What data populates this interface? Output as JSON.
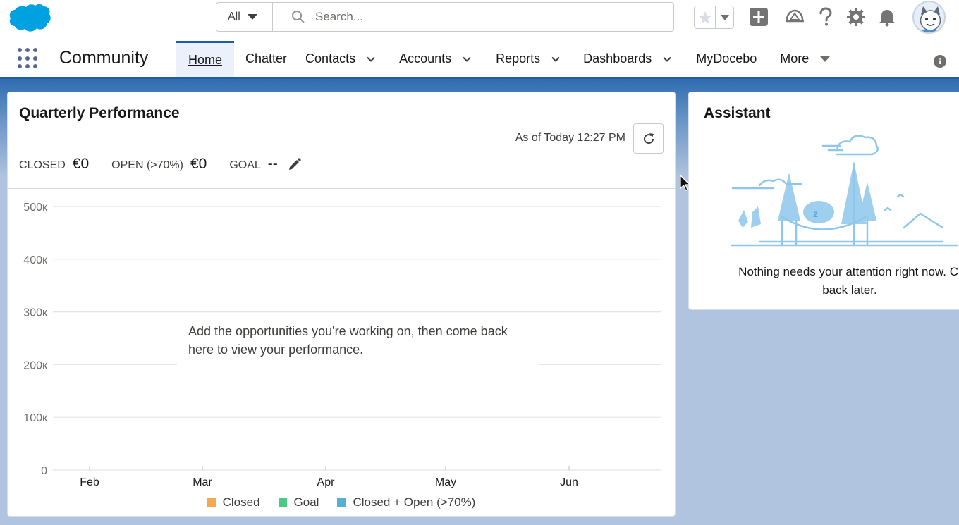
{
  "header": {
    "search_scope": "All",
    "search_placeholder": "Search..."
  },
  "nav": {
    "app_name": "Community",
    "items": [
      {
        "label": "Home",
        "active": true,
        "dropdown": false
      },
      {
        "label": "Chatter",
        "active": false,
        "dropdown": false
      },
      {
        "label": "Contacts",
        "active": false,
        "dropdown": true
      },
      {
        "label": "Accounts",
        "active": false,
        "dropdown": true
      },
      {
        "label": "Reports",
        "active": false,
        "dropdown": true
      },
      {
        "label": "Dashboards",
        "active": false,
        "dropdown": true
      },
      {
        "label": "MyDocebo",
        "active": false,
        "dropdown": false
      },
      {
        "label": "More",
        "active": false,
        "dropdown": true
      }
    ]
  },
  "performance": {
    "title": "Quarterly Performance",
    "as_of": "As of Today 12:27 PM",
    "closed_label": "CLOSED",
    "closed_value": "€0",
    "open_label": "OPEN (>70%)",
    "open_value": "€0",
    "goal_label": "GOAL",
    "goal_value": "--",
    "empty_message_line1": "Add the opportunities you're working on, then come back",
    "empty_message_line2": "here to view your performance."
  },
  "chart_data": {
    "type": "line",
    "x": [
      "Feb",
      "Mar",
      "Apr",
      "May",
      "Jun"
    ],
    "y_ticks": [
      "0",
      "100к",
      "200к",
      "300к",
      "400к",
      "500к"
    ],
    "ylim": [
      0,
      500000
    ],
    "grid": true,
    "series": [
      {
        "name": "Closed",
        "color": "#f4a950",
        "values": []
      },
      {
        "name": "Goal",
        "color": "#4bca81",
        "values": []
      },
      {
        "name": "Closed + Open (>70%)",
        "color": "#54b0d8",
        "values": []
      }
    ],
    "legend_position": "bottom"
  },
  "assistant": {
    "title": "Assistant",
    "message_line1": "Nothing needs your attention right now. Cl",
    "message_line2": "back later."
  },
  "colors": {
    "brand": "#1b5ea6",
    "logo": "#00a1e0",
    "illustration": "#8fc7ec"
  }
}
